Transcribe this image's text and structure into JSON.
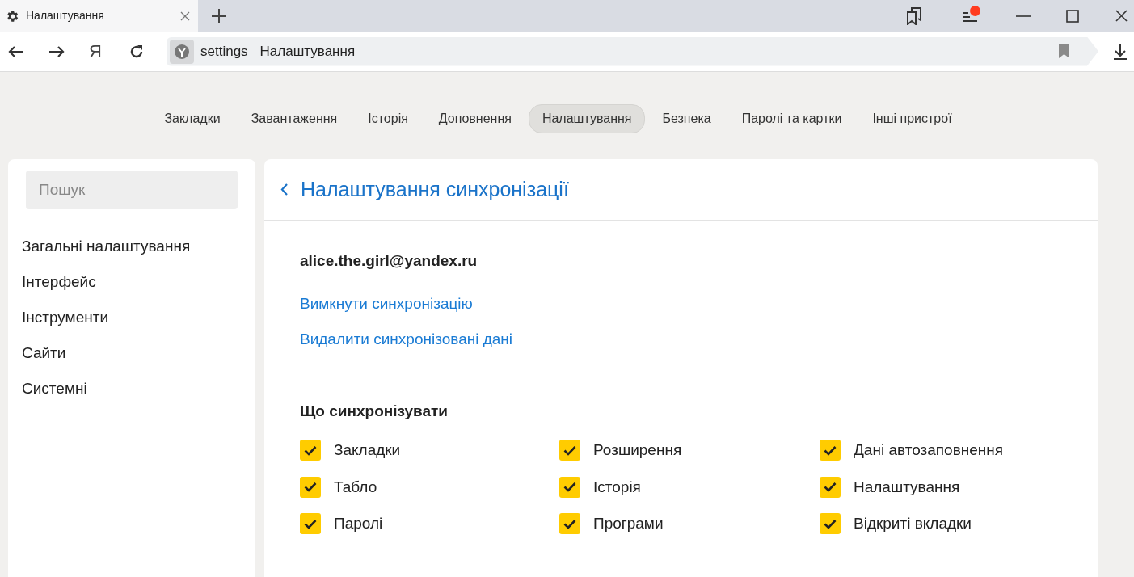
{
  "browser_tab": {
    "title": "Налаштування"
  },
  "toolbar": {
    "logo": "Я",
    "address_host": "settings",
    "address_title": "Налаштування"
  },
  "menu_notification": {
    "color": "#ff3b1f"
  },
  "nav_tabs": [
    {
      "label": "Закладки",
      "selected": false
    },
    {
      "label": "Завантаження",
      "selected": false
    },
    {
      "label": "Історія",
      "selected": false
    },
    {
      "label": "Доповнення",
      "selected": false
    },
    {
      "label": "Налаштування",
      "selected": true
    },
    {
      "label": "Безпека",
      "selected": false
    },
    {
      "label": "Паролі та картки",
      "selected": false
    },
    {
      "label": "Інші пристрої",
      "selected": false
    }
  ],
  "sidebar": {
    "search_placeholder": "Пошук",
    "items": [
      "Загальні налаштування",
      "Інтерфейс",
      "Інструменти",
      "Сайти",
      "Системні"
    ]
  },
  "main": {
    "title": "Налаштування синхронізації",
    "account": "alice.the.girl@yandex.ru",
    "links": [
      "Вимкнути синхронізацію",
      "Видалити синхронізовані дані"
    ],
    "section_title": "Що синхронізувати",
    "options": [
      {
        "label": "Закладки",
        "checked": true
      },
      {
        "label": "Розширення",
        "checked": true
      },
      {
        "label": "Дані автозаповнення",
        "checked": true
      },
      {
        "label": "Табло",
        "checked": true
      },
      {
        "label": "Історія",
        "checked": true
      },
      {
        "label": "Налаштування",
        "checked": true
      },
      {
        "label": "Паролі",
        "checked": true
      },
      {
        "label": "Програми",
        "checked": true
      },
      {
        "label": "Відкриті вкладки",
        "checked": true
      }
    ]
  }
}
